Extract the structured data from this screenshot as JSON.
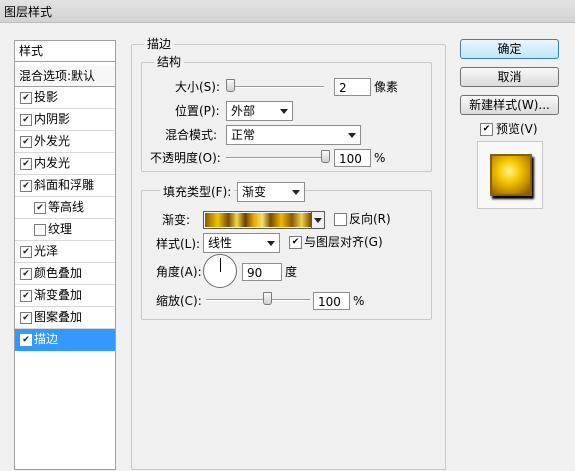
{
  "window": {
    "title": "图层样式"
  },
  "style_list": {
    "header": "样式",
    "blend_options": "混合选项:默认",
    "items": [
      {
        "label": "投影",
        "checked": true,
        "selected": false,
        "sub": false
      },
      {
        "label": "内阴影",
        "checked": true,
        "selected": false,
        "sub": false
      },
      {
        "label": "外发光",
        "checked": true,
        "selected": false,
        "sub": false
      },
      {
        "label": "内发光",
        "checked": true,
        "selected": false,
        "sub": false
      },
      {
        "label": "斜面和浮雕",
        "checked": true,
        "selected": false,
        "sub": false
      },
      {
        "label": "等高线",
        "checked": true,
        "selected": false,
        "sub": true
      },
      {
        "label": "纹理",
        "checked": false,
        "selected": false,
        "sub": true
      },
      {
        "label": "光泽",
        "checked": true,
        "selected": false,
        "sub": false
      },
      {
        "label": "颜色叠加",
        "checked": true,
        "selected": false,
        "sub": false
      },
      {
        "label": "渐变叠加",
        "checked": true,
        "selected": false,
        "sub": false
      },
      {
        "label": "图案叠加",
        "checked": true,
        "selected": false,
        "sub": false
      },
      {
        "label": "描边",
        "checked": true,
        "selected": true,
        "sub": false
      }
    ]
  },
  "stroke": {
    "title": "描边",
    "structure": {
      "title": "结构",
      "size_label": "大小(S):",
      "size_value": "2",
      "size_unit": "像素",
      "size_level": 0.03,
      "position_label": "位置(P):",
      "position_value": "外部",
      "blend_label": "混合模式:",
      "blend_value": "正常",
      "opacity_label": "不透明度(O):",
      "opacity_value": "100",
      "opacity_unit": "%",
      "opacity_level": 1.0
    },
    "fill": {
      "type_label": "填充类型(F):",
      "type_value": "渐变",
      "gradient_label": "渐变:",
      "reverse_label": "反向(R)",
      "reverse_checked": false,
      "style_label": "样式(L):",
      "style_value": "线性",
      "align_label": "与图层对齐(G)",
      "align_checked": true,
      "angle_label": "角度(A):",
      "angle_value": "90",
      "angle_unit": "度",
      "scale_label": "缩放(C):",
      "scale_value": "100",
      "scale_unit": "%",
      "scale_level": 0.45
    }
  },
  "buttons": {
    "ok": "确定",
    "cancel": "取消",
    "new_style": "新建样式(W)...",
    "preview_label": "预览(V)",
    "preview_checked": true
  },
  "colors": {
    "selection": "#3399ff",
    "background": "#f0f0f0"
  }
}
